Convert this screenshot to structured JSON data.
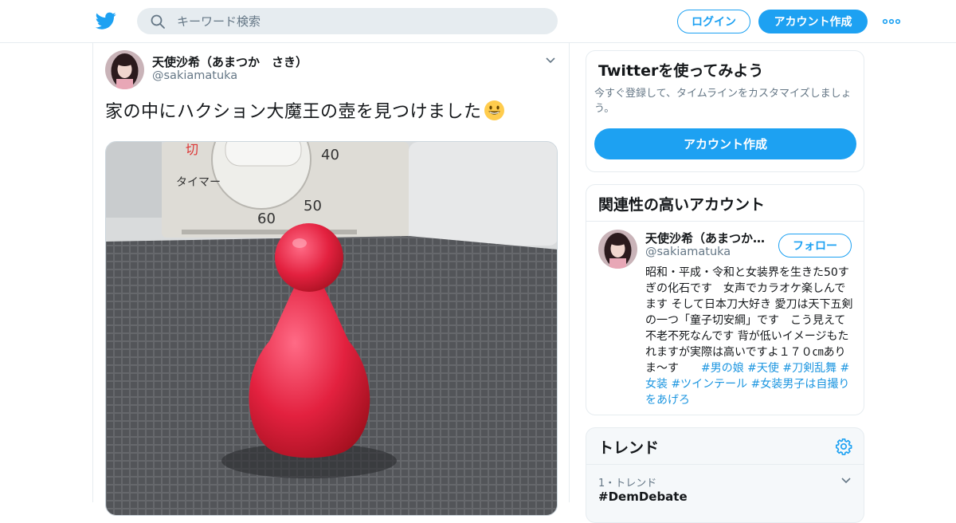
{
  "header": {
    "search_placeholder": "キーワード検索",
    "login_label": "ログイン",
    "signup_label": "アカウント作成",
    "brand_color": "#1da1f2"
  },
  "tweet": {
    "author_name": "天使沙希（あまつか　さき）",
    "author_handle": "@sakiamatuka",
    "text": "家の中にハクション大魔王の壺を見つけました",
    "emoji": "grinning-face-emoji"
  },
  "signup_card": {
    "title": "Twitterを使ってみよう",
    "description": "今すぐ登録して、タイムラインをカスタマイズしましょう。",
    "button_label": "アカウント作成"
  },
  "related": {
    "title": "関連性の高いアカウント",
    "account": {
      "name": "天使沙希（あまつか　さき）",
      "handle": "@sakiamatuka",
      "follow_label": "フォロー",
      "bio_text": "昭和・平成・令和と女装界を生きた50すぎの化石です　女声でカラオケ楽しんでます そして日本刀大好き 愛刀は天下五剣の一つ「童子切安綱」です　こう見えて不老不死なんです 背が低いイメージもたれますが実際は高いですよ１７０㎝ありま～す　　",
      "hashtags": "#男の娘 #天使 #刀剣乱舞 #女装 #ツインテール #女装男子は自撮りをあげろ"
    }
  },
  "trends": {
    "title": "トレンド",
    "items": [
      {
        "meta": "1・トレンド",
        "name": "#DemDebate"
      }
    ]
  }
}
